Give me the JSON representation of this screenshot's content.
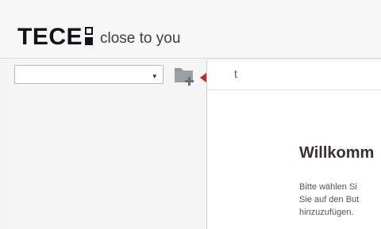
{
  "brand": {
    "wordmark": "TECE",
    "tagline": "close to you"
  },
  "toolbar": {
    "select_value": "",
    "select_caret": "▾",
    "add_folder_icon": "folder-add-icon",
    "pointer_arrow_icon": "red-arrow-icon"
  },
  "main": {
    "tab_label": "t",
    "title": "Willkomm",
    "body_lines": "Bitte wählen Si\nSie auf den But\nhinzuzufügen."
  },
  "colors": {
    "arrow": "#c62828",
    "folder": "#8a8f95",
    "text_dark": "#3a2f38"
  }
}
